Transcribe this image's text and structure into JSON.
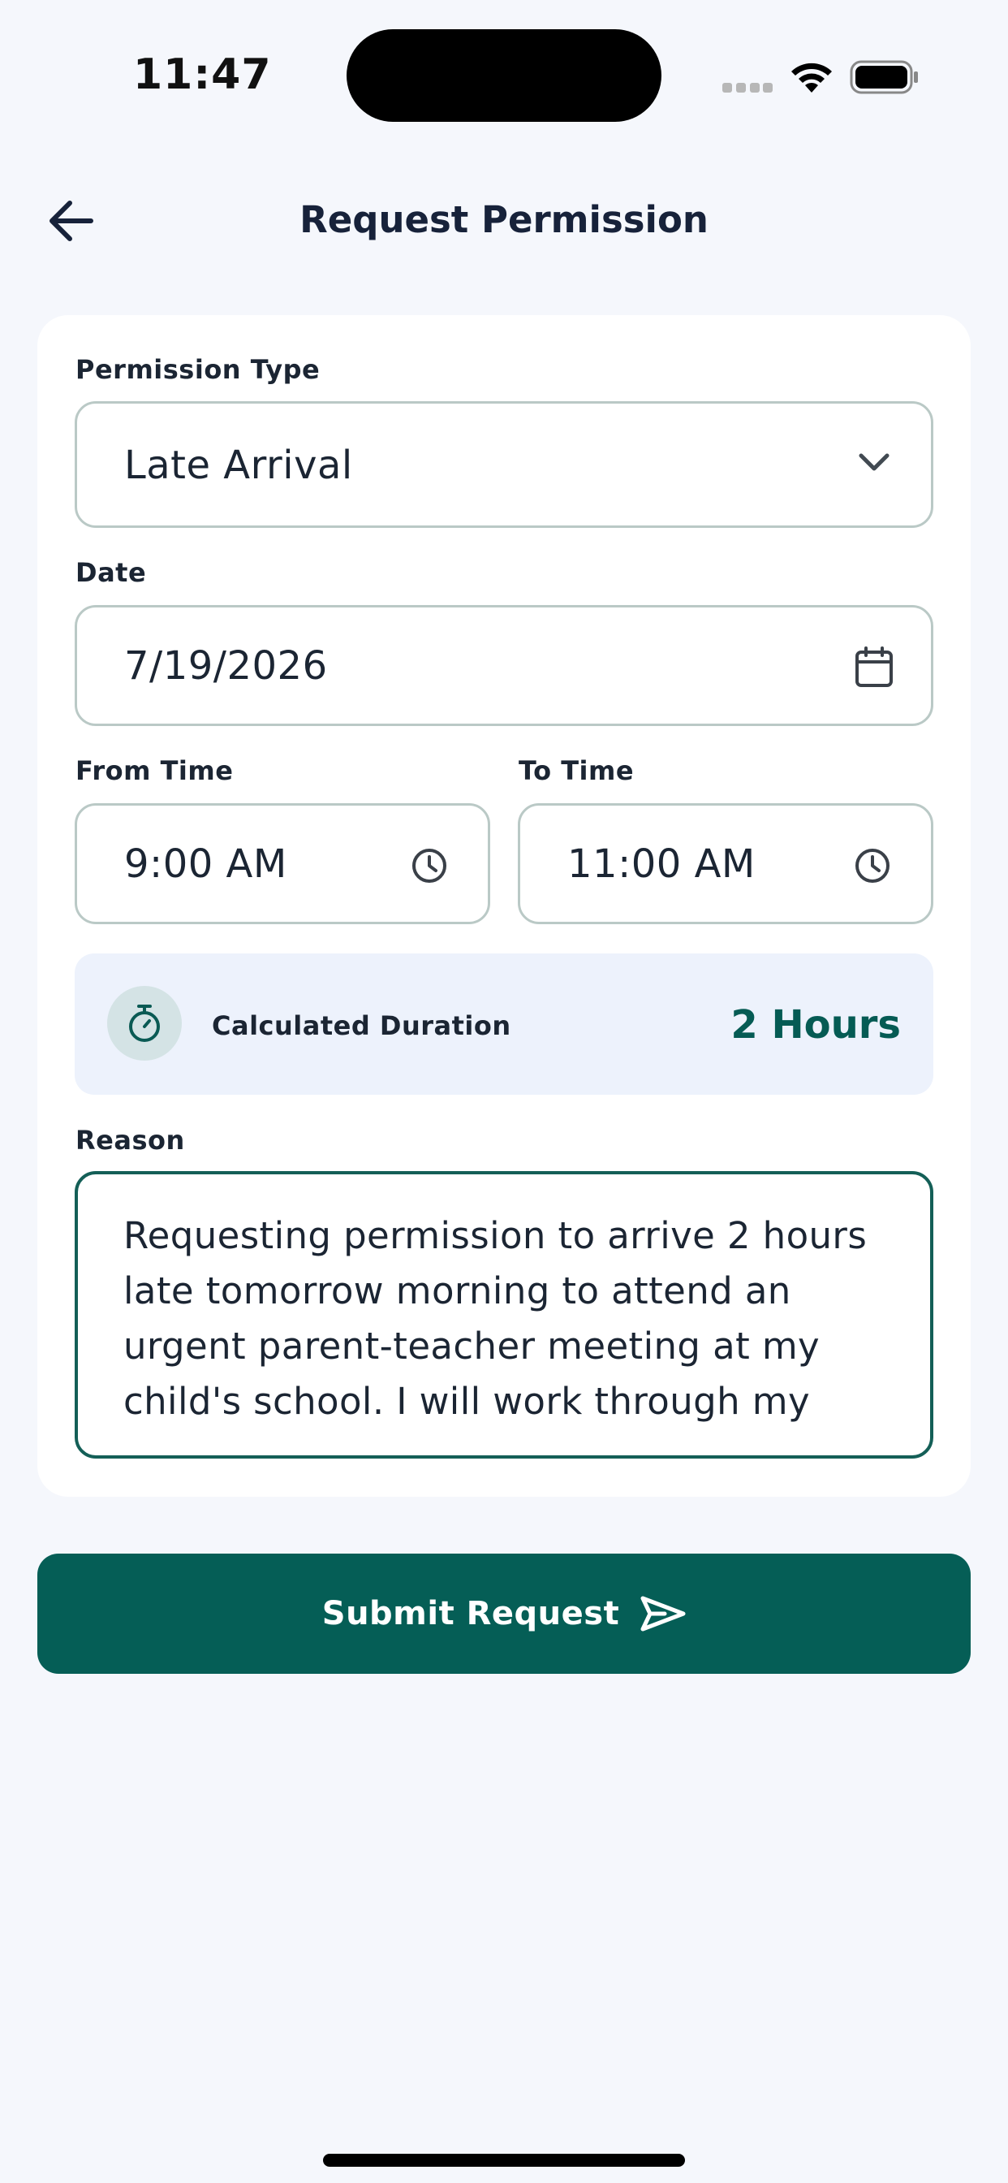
{
  "status_bar": {
    "time": "11:47"
  },
  "header": {
    "title": "Request Permission"
  },
  "form": {
    "permission_type": {
      "label": "Permission Type",
      "value": "Late Arrival"
    },
    "date": {
      "label": "Date",
      "value": "7/19/2026"
    },
    "from_time": {
      "label": "From Time",
      "value": "9:00 AM"
    },
    "to_time": {
      "label": "To Time",
      "value": "11:00 AM"
    },
    "duration": {
      "label": "Calculated Duration",
      "value": "2 Hours"
    },
    "reason": {
      "label": "Reason",
      "value": "Requesting permission to arrive 2 hours late tomorrow morning to attend an urgent parent-teacher meeting at my child's school. I will work through my"
    }
  },
  "actions": {
    "submit_label": "Submit Request"
  },
  "icons": {
    "back": "arrow-left-icon",
    "dropdown": "chevron-down-icon",
    "calendar": "calendar-icon",
    "clock": "clock-icon",
    "timer": "stopwatch-icon",
    "send": "send-icon"
  },
  "colors": {
    "primary": "#055e56",
    "background": "#f5f7fc",
    "card": "#ffffff",
    "duration_bg": "#edf2fc",
    "field_border": "#bac9c6"
  }
}
